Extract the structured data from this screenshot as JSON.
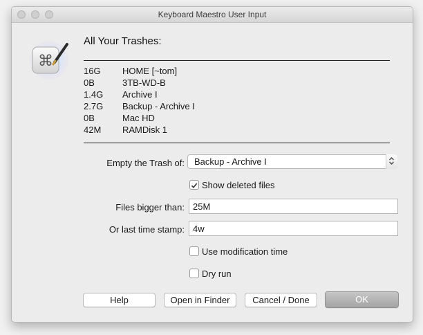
{
  "window": {
    "title": "Keyboard Maestro User Input"
  },
  "heading": "All Your Trashes:",
  "trashes": [
    {
      "size": "16G",
      "name": "HOME [~tom]"
    },
    {
      "size": "0B",
      "name": "3TB-WD-B"
    },
    {
      "size": "1.4G",
      "name": "Archive I"
    },
    {
      "size": "2.7G",
      "name": "Backup - Archive I"
    },
    {
      "size": "0B",
      "name": "Mac HD"
    },
    {
      "size": "42M",
      "name": "RAMDisk 1"
    }
  ],
  "form": {
    "empty_trash_label": "Empty the Trash of:",
    "empty_trash_value": "Backup - Archive I",
    "show_deleted_label": "Show deleted files",
    "show_deleted_checked": true,
    "bigger_than_label": "Files bigger than:",
    "bigger_than_value": "25M",
    "timestamp_label": "Or last time stamp:",
    "timestamp_value": "4w",
    "modification_label": "Use modification time",
    "modification_checked": false,
    "dry_run_label": "Dry run",
    "dry_run_checked": false
  },
  "buttons": {
    "help": "Help",
    "open_finder": "Open in Finder",
    "cancel": "Cancel / Done",
    "ok": "OK"
  },
  "icons": {
    "app": "keyboard-maestro-app-icon",
    "checkmark": "checkmark-icon",
    "stepper": "chevron-up-down-icon"
  }
}
